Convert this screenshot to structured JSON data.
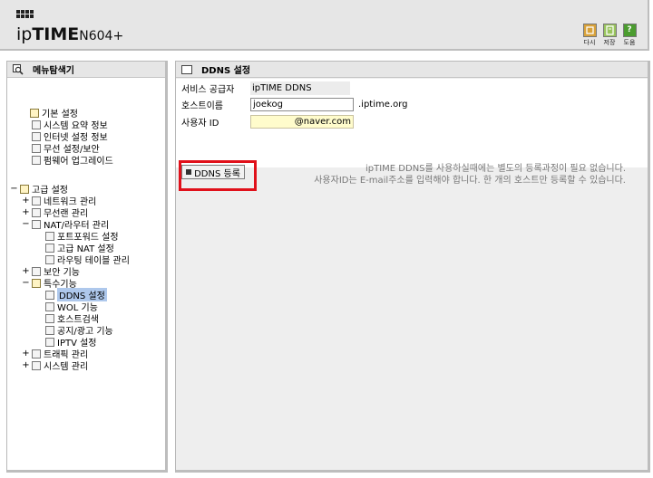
{
  "header": {
    "brand_ip": "ip",
    "brand_time": "TIME",
    "model": "N604+",
    "tools": [
      {
        "icon": "back-icon",
        "label": "다시"
      },
      {
        "icon": "save-icon",
        "label": "저장"
      },
      {
        "icon": "help-icon",
        "label": "도움",
        "glyph": "?"
      }
    ]
  },
  "sidebar": {
    "title": "메뉴탐색기",
    "items": [
      {
        "label": "기본 설정",
        "toggle": ""
      },
      {
        "label": "시스템 요약 정보",
        "toggle": ""
      },
      {
        "label": "인터넷 설정 정보",
        "toggle": ""
      },
      {
        "label": "무선 설정/보안",
        "toggle": ""
      },
      {
        "label": "펌웨어 업그레이드",
        "toggle": ""
      },
      {
        "label": "고급 설정",
        "toggle": "−"
      },
      {
        "label": "네트워크 관리",
        "toggle": "+"
      },
      {
        "label": "무선랜 관리",
        "toggle": "+"
      },
      {
        "label": "NAT/라우터 관리",
        "toggle": "−"
      },
      {
        "label": "포트포워드 설정",
        "toggle": ""
      },
      {
        "label": "고급 NAT 설정",
        "toggle": ""
      },
      {
        "label": "라우팅 테이블 관리",
        "toggle": ""
      },
      {
        "label": "보안 기능",
        "toggle": "+"
      },
      {
        "label": "특수기능",
        "toggle": "−"
      },
      {
        "label": "DDNS 설정",
        "toggle": ""
      },
      {
        "label": "WOL 기능",
        "toggle": ""
      },
      {
        "label": "호스트검색",
        "toggle": ""
      },
      {
        "label": "공지/광고 기능",
        "toggle": ""
      },
      {
        "label": "IPTV 설정",
        "toggle": ""
      },
      {
        "label": "트래픽 관리",
        "toggle": "+"
      },
      {
        "label": "시스템 관리",
        "toggle": "+"
      }
    ]
  },
  "main": {
    "title": "DDNS 설정",
    "provider_label": "서비스 공급자",
    "provider_value": "ipTIME DDNS",
    "host_label": "호스트이름",
    "host_value": "joekog",
    "host_suffix": ".iptime.org",
    "user_label": "사용자 ID",
    "user_value": "@naver.com",
    "register_button": "DDNS 등록",
    "info_line1": "ipTIME DDNS를 사용하실때에는 별도의 등록과정이 필요 없습니다.",
    "info_line2": "사용자ID는 E-mail주소를 입력해야 합니다. 한 개의 호스트만 등록할 수 있습니다."
  },
  "colors": {
    "highlight_frame": "#e0101a",
    "selected_item_bg": "#aec8ec",
    "userid_bg": "#fffccc"
  }
}
